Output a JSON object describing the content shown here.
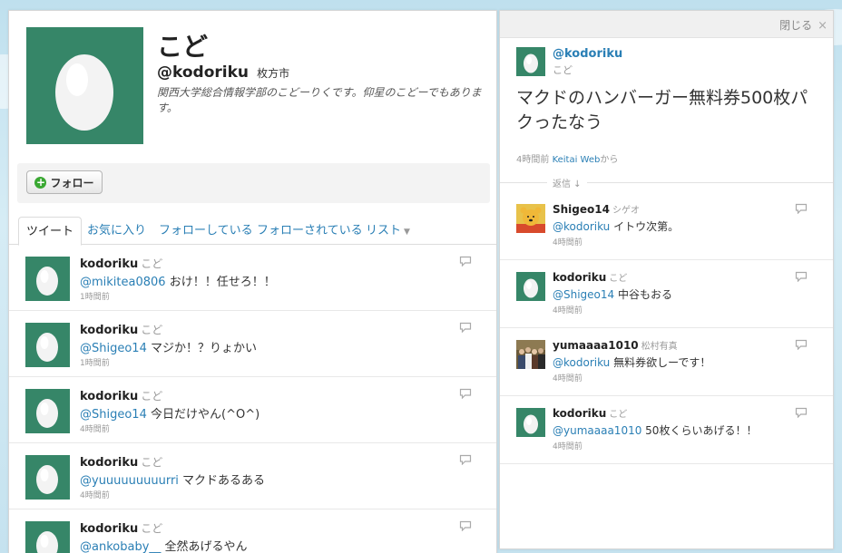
{
  "profile": {
    "name": "こど",
    "handle": "@kodoriku",
    "location": "枚方市",
    "bio": "関西大学総合情報学部のこどーりくです。仰星のこどーでもあります。",
    "follow_label": "フォロー"
  },
  "tabs": [
    {
      "label": "ツイート",
      "active": true
    },
    {
      "label": "お気に入り",
      "active": false
    },
    {
      "label": "フォローしている",
      "active": false
    },
    {
      "label": "フォローされている",
      "active": false
    },
    {
      "label": "リスト",
      "active": false
    }
  ],
  "timeline": [
    {
      "author": "kodoriku",
      "fullname": "こど",
      "mention": "@mikitea0806",
      "text": " おけ！！任せろ！！",
      "time": "1時間前"
    },
    {
      "author": "kodoriku",
      "fullname": "こど",
      "mention": "@Shigeo14",
      "text": " マジか！？りょかい",
      "time": "1時間前"
    },
    {
      "author": "kodoriku",
      "fullname": "こど",
      "mention": "@Shigeo14",
      "text": " 今日だけやん(^O^)",
      "time": "4時間前"
    },
    {
      "author": "kodoriku",
      "fullname": "こど",
      "mention": "@yuuuuuuuuurri",
      "text": " マクドあるある",
      "time": "4時間前"
    },
    {
      "author": "kodoriku",
      "fullname": "こど",
      "mention": "@ankobaby__",
      "text": " 全然あげるやん",
      "time": ""
    }
  ],
  "detail": {
    "close_label": "閉じる",
    "close_x": "×",
    "handle": "@kodoriku",
    "name": "こど",
    "text": "マクドのハンバーガー無料券500枚パクったなう",
    "time": "4時間前",
    "source": "Keitai Web",
    "source_suffix": "から",
    "replies_label": "返信 ↓"
  },
  "replies": [
    {
      "author": "Shigeo14",
      "fullname": "シゲオ",
      "mention": "@kodoriku",
      "text": " イトウ次第。",
      "time": "4時間前",
      "avatar": "pooh"
    },
    {
      "author": "kodoriku",
      "fullname": "こど",
      "mention": "@Shigeo14",
      "text": " 中谷もおる",
      "time": "4時間前",
      "avatar": "egg"
    },
    {
      "author": "yumaaaa1010",
      "fullname": "松村有真",
      "mention": "@kodoriku",
      "text": " 無料券欲しーです！",
      "time": "4時間前",
      "avatar": "group"
    },
    {
      "author": "kodoriku",
      "fullname": "こど",
      "mention": "@yumaaaa1010",
      "text": " 50枚くらいあげる！！",
      "time": "4時間前",
      "avatar": "egg"
    }
  ],
  "colors": {
    "egg_bg": "#368668",
    "link": "#2a7fb5"
  }
}
